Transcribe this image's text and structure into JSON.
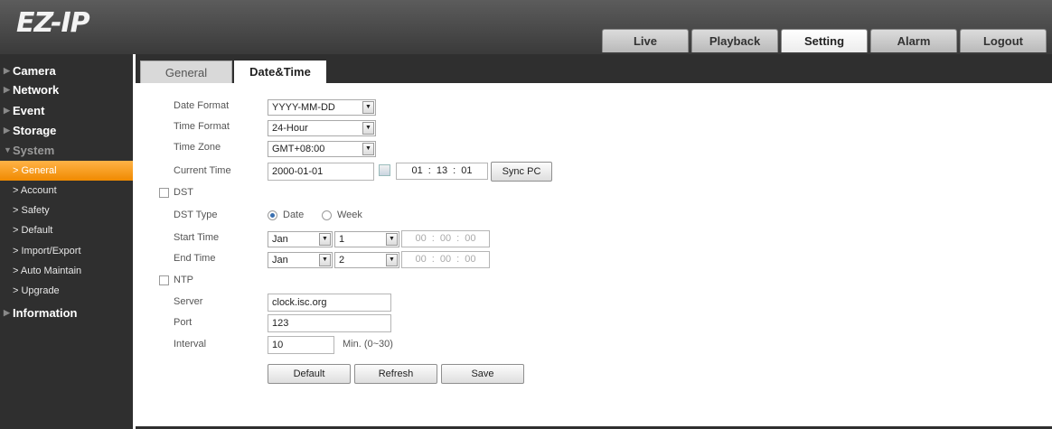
{
  "brand": {
    "logo": "EZ-IP"
  },
  "nav": {
    "tabs": [
      "Live",
      "Playback",
      "Setting",
      "Alarm",
      "Logout"
    ],
    "active": "Setting"
  },
  "sidebar": {
    "camera": "Camera",
    "network": "Network",
    "event": "Event",
    "storage": "Storage",
    "system": "System",
    "system_items": [
      "> General",
      "> Account",
      "> Safety",
      "> Default",
      "> Import/Export",
      "> Auto Maintain",
      "> Upgrade"
    ],
    "information": "Information"
  },
  "content": {
    "tabs": [
      "General",
      "Date&Time"
    ],
    "active_tab": "Date&Time",
    "date_format": {
      "label": "Date Format",
      "value": "YYYY-MM-DD"
    },
    "time_format": {
      "label": "Time Format",
      "value": "24-Hour"
    },
    "time_zone": {
      "label": "Time Zone",
      "value": "GMT+08:00"
    },
    "current_time": {
      "label": "Current Time",
      "date": "2000-01-01",
      "time": "01 : 13 : 01",
      "sync_label": "Sync PC"
    },
    "dst": {
      "label": "DST",
      "checked": false
    },
    "dst_type": {
      "label": "DST Type",
      "options": [
        "Date",
        "Week"
      ],
      "selected": "Date"
    },
    "start_time": {
      "label": "Start Time",
      "month": "Jan",
      "day": "1",
      "time": "00 : 00 : 00"
    },
    "end_time": {
      "label": "End Time",
      "month": "Jan",
      "day": "2",
      "time": "00 : 00 : 00"
    },
    "ntp": {
      "label": "NTP",
      "checked": false
    },
    "server": {
      "label": "Server",
      "value": "clock.isc.org"
    },
    "port": {
      "label": "Port",
      "value": "123"
    },
    "interval": {
      "label": "Interval",
      "value": "10",
      "unit": "Min. (0~30)"
    },
    "buttons": {
      "default": "Default",
      "refresh": "Refresh",
      "save": "Save"
    }
  }
}
